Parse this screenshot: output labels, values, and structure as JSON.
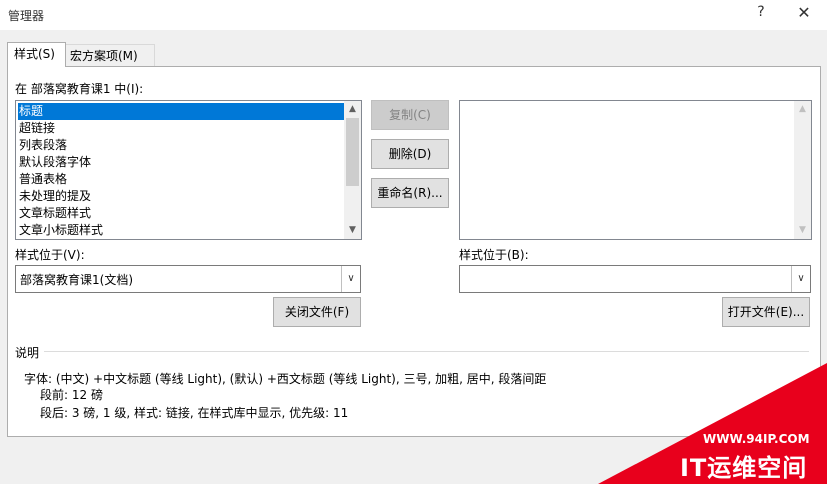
{
  "window": {
    "title": "管理器",
    "help_label": "?",
    "close_label": "✕"
  },
  "tabs": [
    {
      "label": "样式(S)",
      "active": true
    },
    {
      "label": "宏方案项(M)",
      "active": false
    }
  ],
  "left": {
    "list_label": "在 部落窝教育课1 中(I):",
    "items": [
      "标题",
      "超链接",
      "列表段落",
      "默认段落字体",
      "普通表格",
      "未处理的提及",
      "文章标题样式",
      "文章小标题样式"
    ],
    "selected_index": 0,
    "location_label": "样式位于(V):",
    "location_value": "部落窝教育课1(文档)",
    "close_file_button": "关闭文件(F)"
  },
  "middle": {
    "copy_button": "复制(C)",
    "delete_button": "删除(D)",
    "rename_button": "重命名(R)..."
  },
  "right": {
    "location_label": "样式位于(B):",
    "location_value": "",
    "open_file_button": "打开文件(E)..."
  },
  "description": {
    "label": "说明",
    "line1": "字体: (中文) +中文标题 (等线 Light), (默认) +西文标题 (等线 Light), 三号, 加粗, 居中, 段落间距",
    "line2": "段前: 12 磅",
    "line3": "段后: 3 磅, 1 级, 样式: 链接, 在样式库中显示, 优先级: 11"
  },
  "watermark": {
    "url": "WWW.94IP.COM",
    "title": "IT运维空间"
  },
  "icons": {
    "up": "▲",
    "down": "▼",
    "dropdown": "∨"
  }
}
